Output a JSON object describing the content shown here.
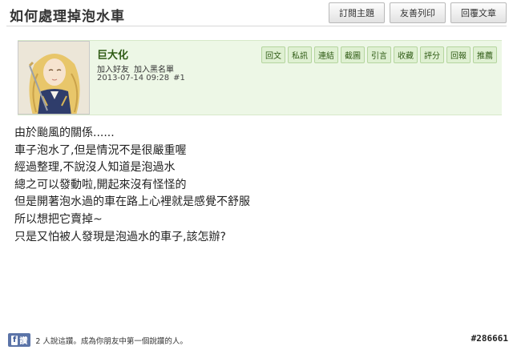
{
  "thread": {
    "title": "如何處理掉泡水車"
  },
  "toolbar": {
    "subscribe": "訂閱主題",
    "print": "友善列印",
    "reply": "回覆文章"
  },
  "post": {
    "author": "巨大化",
    "add_friend": "加入好友",
    "add_blacklist": "加入黑名單",
    "datetime": "2013-07-14 09:28",
    "floor": "#1",
    "actions": [
      "回文",
      "私訊",
      "連結",
      "截圖",
      "引言",
      "收藏",
      "評分",
      "回報",
      "推薦"
    ],
    "lines": [
      "由於颱風的關係......",
      "車子泡水了,但是情況不是很嚴重喔",
      "經過整理,不說沒人知道是泡過水",
      "總之可以發動啦,開起來沒有怪怪的",
      "但是開著泡水過的車在路上心裡就是感覺不舒服",
      "所以想把它賣掉~",
      "只是又怕被人發現是泡過水的車子,該怎辦?"
    ]
  },
  "facebook": {
    "icon": "facebook-icon",
    "button_label": "讚",
    "text": "2 人說這讚。成為你朋友中第一個說讚的人。"
  },
  "watermark": "#286661"
}
